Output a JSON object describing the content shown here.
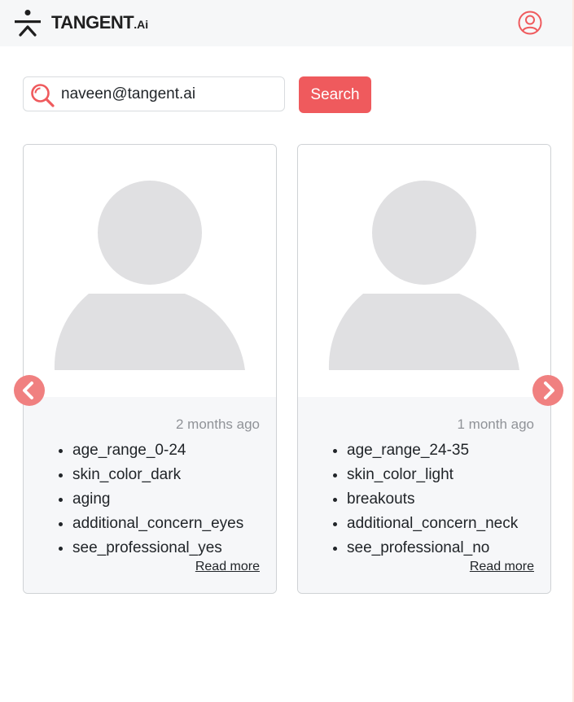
{
  "header": {
    "logo_text": "TANGENT",
    "logo_suffix": ".Ai",
    "logo_icon": "tangent-logo-icon",
    "user_icon": "user-circle-icon"
  },
  "search": {
    "value": "naveen@tangent.ai",
    "placeholder": "",
    "button_label": "Search",
    "icon": "search-icon"
  },
  "carousel": {
    "prev_icon": "chevron-left-icon",
    "next_icon": "chevron-right-icon",
    "cards": [
      {
        "time": "2 months ago",
        "tags": [
          "age_range_0-24",
          "skin_color_dark",
          "aging",
          "additional_concern_eyes",
          "see_professional_yes"
        ],
        "read_more": "Read more"
      },
      {
        "time": "1 month ago",
        "tags": [
          "age_range_24-35",
          "skin_color_light",
          "breakouts",
          "additional_concern_neck",
          "see_professional_no"
        ],
        "read_more": "Read more"
      }
    ]
  },
  "colors": {
    "accent": "#ef5a5d",
    "arrow": "#f08080",
    "placeholder_avatar": "#e0e0e2",
    "card_body": "#f6f7f9",
    "header_bg": "#f6f7f8"
  }
}
